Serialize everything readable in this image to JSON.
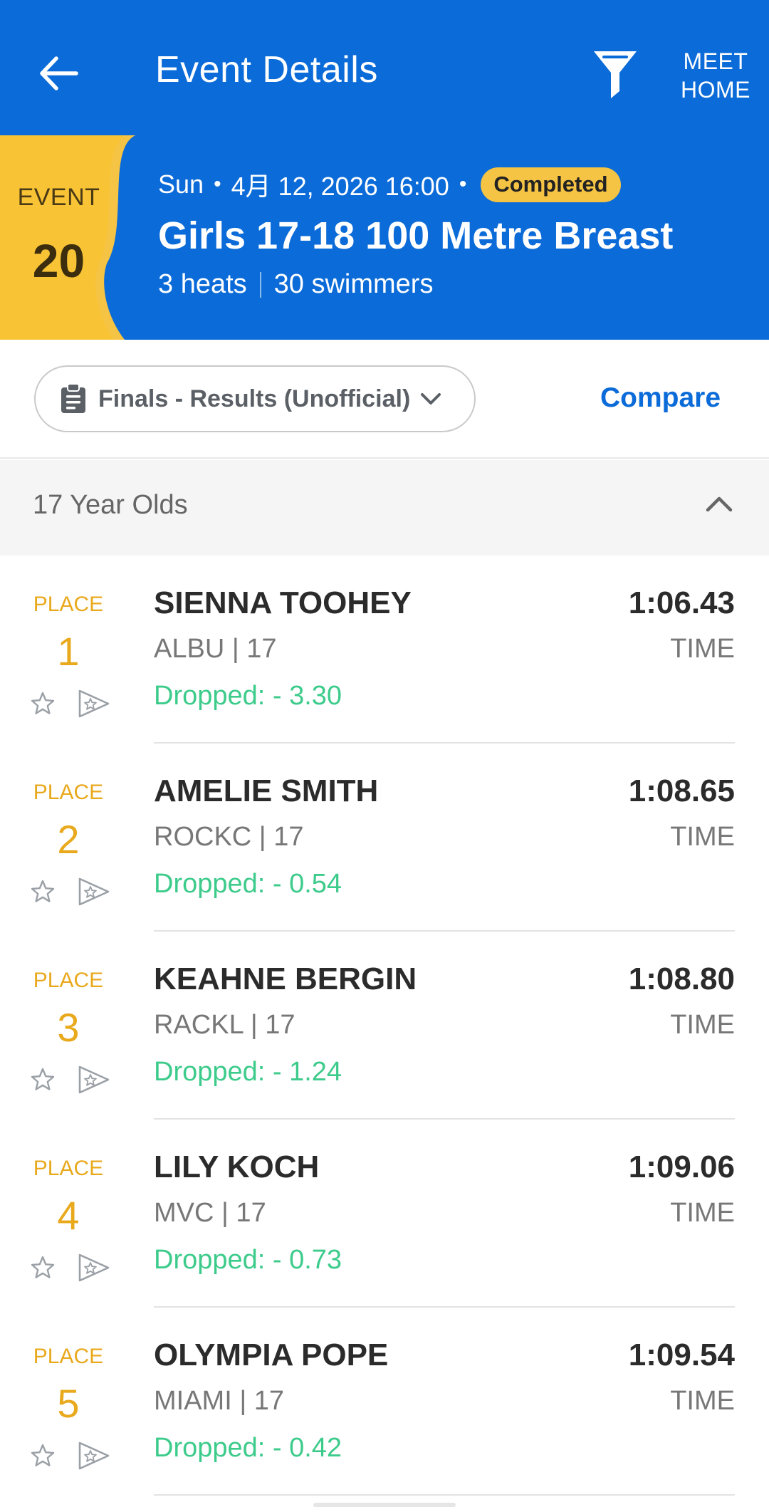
{
  "app": {
    "title": "Event Details",
    "meet_home": "MEET HOME",
    "icons": {
      "back": "arrow-left-icon",
      "filter": "filter-icon"
    }
  },
  "event": {
    "badge_label": "EVENT",
    "number": "20",
    "day": "Sun",
    "date_time": "4月 12, 2026 16:00",
    "status": "Completed",
    "title": "Girls 17-18 100 Metre Breast",
    "heats": "3 heats",
    "swimmers": "30 swimmers"
  },
  "colors": {
    "brand_blue": "#0B6BD8",
    "badge_yellow": "#F6C444",
    "place_gold": "#E9A91D",
    "dropped_green": "#3DCB8B"
  },
  "toolbar": {
    "round_select": "Finals - Results (Unofficial)",
    "compare": "Compare"
  },
  "group": {
    "label": "17 Year Olds",
    "expanded": true
  },
  "results": [
    {
      "place_label": "PLACE",
      "place": "1",
      "name": "SIENNA TOOHEY",
      "team": "ALBU | 17",
      "dropped": "Dropped: - 3.30",
      "time": "1:06.43",
      "time_label": "TIME"
    },
    {
      "place_label": "PLACE",
      "place": "2",
      "name": "AMELIE SMITH",
      "team": "ROCKC | 17",
      "dropped": "Dropped: - 0.54",
      "time": "1:08.65",
      "time_label": "TIME"
    },
    {
      "place_label": "PLACE",
      "place": "3",
      "name": "KEAHNE BERGIN",
      "team": "RACKL | 17",
      "dropped": "Dropped: - 1.24",
      "time": "1:08.80",
      "time_label": "TIME"
    },
    {
      "place_label": "PLACE",
      "place": "4",
      "name": "LILY KOCH",
      "team": "MVC | 17",
      "dropped": "Dropped: - 0.73",
      "time": "1:09.06",
      "time_label": "TIME"
    },
    {
      "place_label": "PLACE",
      "place": "5",
      "name": "OLYMPIA POPE",
      "team": "MIAMI | 17",
      "dropped": "Dropped: - 0.42",
      "time": "1:09.54",
      "time_label": "TIME"
    }
  ]
}
